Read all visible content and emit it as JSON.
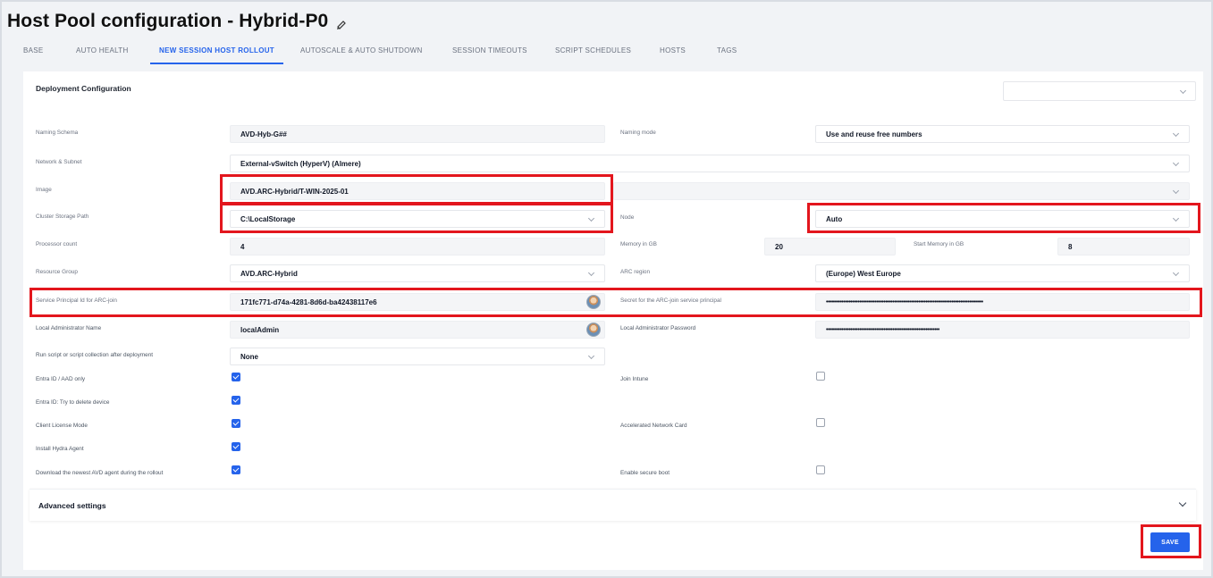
{
  "page": {
    "title": "Host Pool configuration - Hybrid-P0"
  },
  "tabs": [
    {
      "label": "BASE"
    },
    {
      "label": "AUTO HEALTH"
    },
    {
      "label": "NEW SESSION HOST ROLLOUT",
      "active": true
    },
    {
      "label": "AUTOSCALE & AUTO SHUTDOWN"
    },
    {
      "label": "SESSION TIMEOUTS"
    },
    {
      "label": "SCRIPT SCHEDULES"
    },
    {
      "label": "HOSTS"
    },
    {
      "label": "TAGS"
    }
  ],
  "card": {
    "title": "Deployment Configuration",
    "top_select_value": ""
  },
  "fields": {
    "naming_schema": {
      "label": "Naming Schema",
      "value": "AVD-Hyb-G##"
    },
    "naming_mode": {
      "label": "Naming mode",
      "value": "Use and reuse free numbers"
    },
    "network_subnet": {
      "label": "Network & Subnet",
      "value": "External-vSwitch (HyperV) (Almere)"
    },
    "image": {
      "label": "Image",
      "value": "AVD.ARC-Hybrid/T-WIN-2025-01",
      "secondary_value": ""
    },
    "cluster_storage_path": {
      "label": "Cluster Storage Path",
      "value": "C:\\LocalStorage"
    },
    "node": {
      "label": "Node",
      "value": "Auto"
    },
    "processor_count": {
      "label": "Processor count",
      "value": "4"
    },
    "memory_gb": {
      "label": "Memory in GB",
      "value": "20"
    },
    "start_memory_gb": {
      "label": "Start Memory in GB",
      "value": "8"
    },
    "resource_group": {
      "label": "Resource Group",
      "value": "AVD.ARC-Hybrid"
    },
    "arc_region": {
      "label": "ARC region",
      "value": "(Europe) West Europe"
    },
    "sp_id": {
      "label": "Service Principal Id for ARC-join",
      "value": "171fc771-d74a-4281-8d6d-ba42438117e6"
    },
    "sp_secret": {
      "label": "Secret for the ARC-join service principal",
      "value": "••••••••••••••••••••••••••••••••••••••••••••••••••••••••••••••••••••••••••••••••••••••••••"
    },
    "local_admin_name": {
      "label": "Local Administrator Name",
      "value": "localAdmin"
    },
    "local_admin_password": {
      "label": "Local Administrator Password",
      "value": "•••••••••••••••••••••••••••••••••••••••••••••••••••••••••••••••••"
    },
    "run_script": {
      "label": "Run script or script collection after deployment",
      "value": "None"
    }
  },
  "checkboxes": {
    "entra_only": {
      "label": "Entra ID / AAD only",
      "checked": true
    },
    "join_intune": {
      "label": "Join Intune",
      "checked": false
    },
    "entra_delete": {
      "label": "Entra ID: Try to delete device",
      "checked": true
    },
    "client_license": {
      "label": "Client License Mode",
      "checked": true
    },
    "accel_network": {
      "label": "Accelerated Network Card",
      "checked": false
    },
    "install_hydra": {
      "label": "Install Hydra Agent",
      "checked": true
    },
    "download_avd": {
      "label": "Download the newest AVD agent during the rollout",
      "checked": true
    },
    "secure_boot": {
      "label": "Enable secure boot",
      "checked": false
    }
  },
  "advanced": {
    "label": "Advanced settings"
  },
  "actions": {
    "save_label": "SAVE"
  },
  "colors": {
    "accent": "#2563eb",
    "highlight": "#e3161d"
  }
}
